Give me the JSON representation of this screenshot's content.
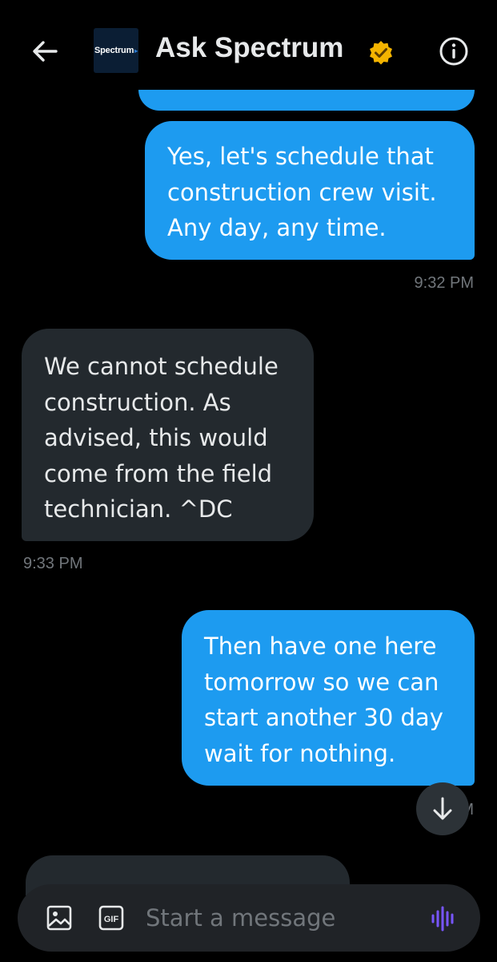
{
  "header": {
    "avatar_text": "Spectrum",
    "title": "Ask Spectrum",
    "icons": [
      "back-arrow-icon",
      "verified-badge-icon",
      "info-icon"
    ],
    "badge_color": "#f4b400"
  },
  "messages": [
    {
      "direction": "outgoing",
      "text": "Yes, let's schedule that\nconstruction crew visit.\nAny day, any time.",
      "time": "9:32 PM"
    },
    {
      "direction": "incoming",
      "text": "We cannot schedule\nconstruction. As\nadvised, this would\ncome from the field\ntechnician. ^DC",
      "time": "9:33 PM"
    },
    {
      "direction": "outgoing",
      "text": "Then have one here\ntomorrow so we can\nstart another 30 day\nwait for nothing.",
      "time": "9    M"
    }
  ],
  "composer": {
    "placeholder": "Start a message",
    "icons": [
      "image-icon",
      "gif-icon",
      "voice-message-icon"
    ]
  },
  "colors": {
    "background": "#000000",
    "outgoing_bubble": "#1d9bf0",
    "incoming_bubble": "#23292e",
    "voice_accent": "#7856ff"
  }
}
